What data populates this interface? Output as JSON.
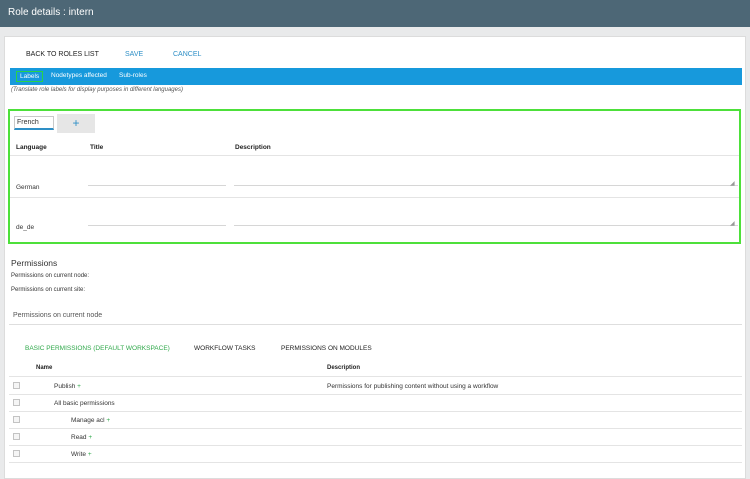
{
  "window": {
    "title": "Role details : intern"
  },
  "actions": {
    "back": "BACK TO ROLES LIST",
    "save": "SAVE",
    "cancel": "CANCEL"
  },
  "tabs": [
    {
      "label": "Labels",
      "active": true
    },
    {
      "label": "Nodetypes affected",
      "active": false
    },
    {
      "label": "Sub-roles",
      "active": false
    }
  ],
  "labels_hint": "(Translate role labels for display purposes in different languages)",
  "labels_panel": {
    "language_input_value": "French",
    "add_symbol": "+",
    "columns": {
      "language": "Language",
      "title": "Title",
      "description": "Description"
    },
    "rows": [
      {
        "language": "German",
        "title": "",
        "description": ""
      },
      {
        "language": "de_de",
        "title": "",
        "description": ""
      }
    ]
  },
  "permissions": {
    "heading": "Permissions",
    "current_node": "Permissions on current node:",
    "current_site": "Permissions on current site:",
    "section_title": "Permissions on current node",
    "tabs": [
      {
        "label": "BASIC PERMISSIONS (DEFAULT WORKSPACE)",
        "active": true
      },
      {
        "label": "WORKFLOW TASKS",
        "active": false
      },
      {
        "label": "PERMISSIONS ON MODULES",
        "active": false
      }
    ],
    "table": {
      "headers": {
        "name": "Name",
        "description": "Description"
      },
      "plus_symbol": "+",
      "rows": [
        {
          "name": "Publish",
          "description": "Permissions for publishing content without using a workflow",
          "has_plus": true
        },
        {
          "name": "All basic permissions",
          "description": "",
          "has_plus": false
        },
        {
          "name": "Manage acl",
          "description": "",
          "has_plus": true
        },
        {
          "name": "Read",
          "description": "",
          "has_plus": true
        },
        {
          "name": "Write",
          "description": "",
          "has_plus": true
        }
      ]
    }
  },
  "colors": {
    "titlebar": "#4d6776",
    "tabbar": "#1799dc",
    "link": "#2e8fc6",
    "highlight": "#4de03a",
    "active_perm_tab": "#2fa84a"
  },
  "icons": {
    "resize_grip": "resize-grip-icon",
    "add": "plus-icon"
  }
}
